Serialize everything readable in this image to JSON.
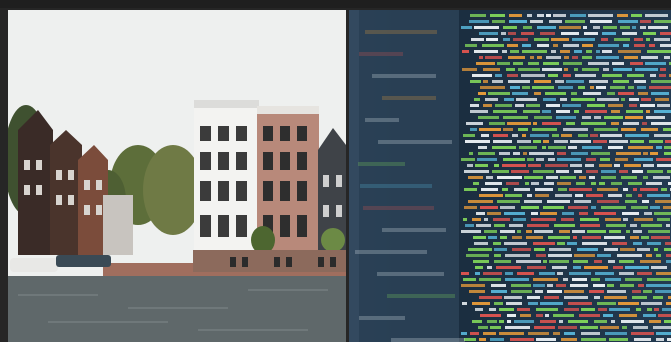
{
  "images": [
    {
      "id": "left",
      "description_icon": "canal-houses-photo"
    },
    {
      "id": "right",
      "description_icon": "code-screen-photo"
    }
  ],
  "colors": {
    "sky": "#e9ebea",
    "water": "#5b6466",
    "code_bg": "#1f3346",
    "code_green": "#7fd35a",
    "code_orange": "#e59a3a",
    "code_red": "#d9534f",
    "code_white": "#e8eef2",
    "code_cyan": "#56b3d6"
  }
}
